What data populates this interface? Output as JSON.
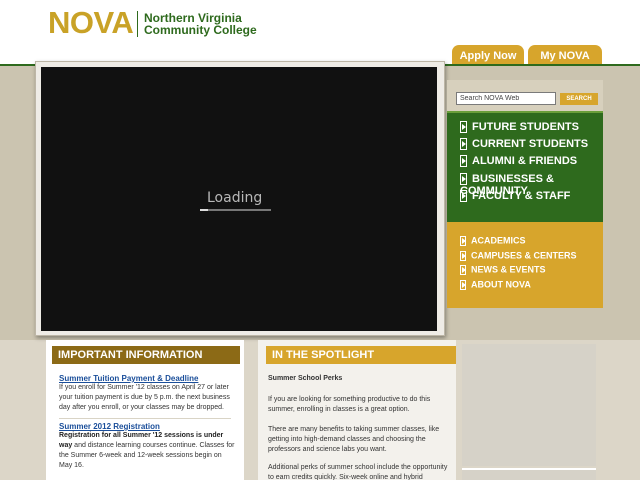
{
  "header": {
    "logo_nova": "NOVA",
    "logo_line1": "Northern Virginia",
    "logo_line2": "Community College",
    "tab_apply": "Apply Now",
    "tab_mynova": "My NOVA"
  },
  "video": {
    "loading_text": "Loading"
  },
  "search": {
    "placeholder": "Search NOVA Web",
    "button_label": "SEARCH"
  },
  "primary_nav": [
    {
      "label": "FUTURE STUDENTS"
    },
    {
      "label": "CURRENT STUDENTS"
    },
    {
      "label": "ALUMNI & FRIENDS"
    },
    {
      "label": "BUSINESSES & COMMUNITY"
    },
    {
      "label": "FACULTY & STAFF"
    }
  ],
  "secondary_nav": [
    {
      "label": "ACADEMICS"
    },
    {
      "label": "CAMPUSES & CENTERS"
    },
    {
      "label": "NEWS & EVENTS"
    },
    {
      "label": "ABOUT NOVA"
    }
  ],
  "important_info": {
    "heading": "IMPORTANT INFORMATION",
    "items": [
      {
        "title": "Summer Tuition Payment & Deadline",
        "text": "If you enroll for Summer '12 classes on April 27 or later your tuition payment is due by 5 p.m. the next business day after you enroll, or your classes may be dropped."
      },
      {
        "title": "Summer 2012 Registration",
        "bold_text": "Registration for all Summer '12 sessions is under way",
        "text": " and distance learning courses continue. Classes for the Summer 6-week and 12-week sessions begin on May 16."
      }
    ]
  },
  "spotlight": {
    "heading": "IN THE SPOTLIGHT",
    "title": "Summer School Perks",
    "paragraphs": [
      "If you are looking for something productive to do this summer, enrolling in classes is a great option.",
      "There are many benefits to taking summer classes, like getting into high-demand classes and choosing the professors and science labs you want.",
      "Additional perks of summer school include the opportunity to earn credits quickly. Six-week online and hybrid"
    ]
  },
  "colors": {
    "gold": "#d7a52c",
    "dark_gold": "#8c6a16",
    "green": "#2e6a1d",
    "link_blue": "#1a4e9a"
  }
}
